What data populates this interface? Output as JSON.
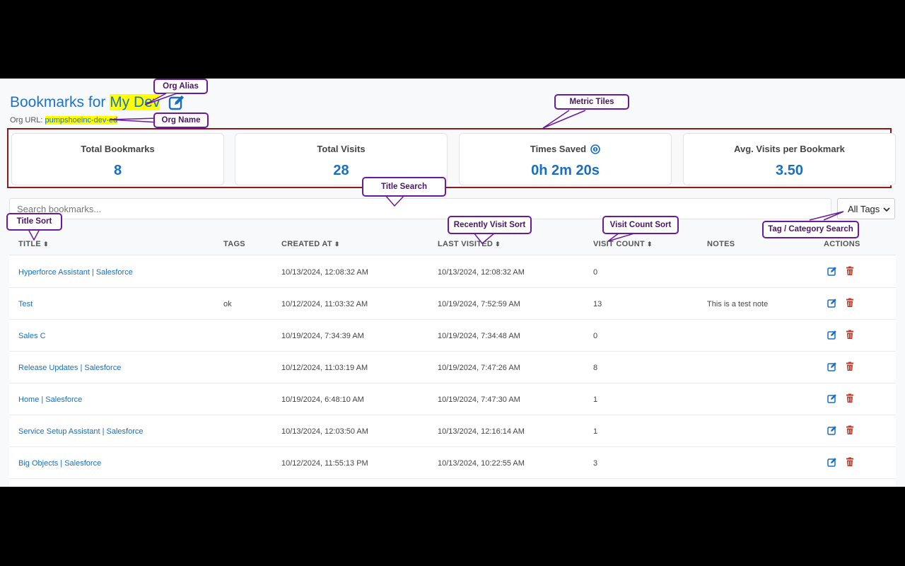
{
  "header": {
    "title_prefix": "Bookmarks for ",
    "org_alias": "My Dev",
    "org_url_label": "Org URL: ",
    "org_url_value": "pumpshoeinc-dev-ed"
  },
  "metrics": [
    {
      "label": "Total Bookmarks",
      "value": "8"
    },
    {
      "label": "Total Visits",
      "value": "28"
    },
    {
      "label": "Times Saved",
      "value": "0h 2m 20s"
    },
    {
      "label": "Avg. Visits per Bookmark",
      "value": "3.50"
    }
  ],
  "search": {
    "placeholder": "Search bookmarks..."
  },
  "tag_filter": {
    "selected": "All Tags"
  },
  "table": {
    "headers": {
      "title": "TITLE",
      "tags": "TAGS",
      "created": "CREATED AT",
      "last_visited": "LAST VISITED",
      "visit_count": "VISIT COUNT",
      "notes": "NOTES",
      "actions": "ACTIONS"
    },
    "rows": [
      {
        "title": "Hyperforce Assistant | Salesforce",
        "tags": "",
        "created": "10/13/2024, 12:08:32 AM",
        "last_visited": "10/13/2024, 12:08:32 AM",
        "visit_count": "0",
        "notes": ""
      },
      {
        "title": "Test",
        "tags": "ok",
        "created": "10/12/2024, 11:03:32 AM",
        "last_visited": "10/19/2024, 7:52:59 AM",
        "visit_count": "13",
        "notes": "This is a test note"
      },
      {
        "title": "Sales C",
        "tags": "",
        "created": "10/19/2024, 7:34:39 AM",
        "last_visited": "10/19/2024, 7:34:48 AM",
        "visit_count": "0",
        "notes": ""
      },
      {
        "title": "Release Updates | Salesforce",
        "tags": "",
        "created": "10/12/2024, 11:03:19 AM",
        "last_visited": "10/19/2024, 7:47:26 AM",
        "visit_count": "8",
        "notes": ""
      },
      {
        "title": "Home | Salesforce",
        "tags": "",
        "created": "10/19/2024, 6:48:10 AM",
        "last_visited": "10/19/2024, 7:47:30 AM",
        "visit_count": "1",
        "notes": ""
      },
      {
        "title": "Service Setup Assistant | Salesforce",
        "tags": "",
        "created": "10/13/2024, 12:03:50 AM",
        "last_visited": "10/13/2024, 12:16:14 AM",
        "visit_count": "1",
        "notes": ""
      },
      {
        "title": "Big Objects | Salesforce",
        "tags": "",
        "created": "10/12/2024, 11:55:13 PM",
        "last_visited": "10/13/2024, 10:22:55 AM",
        "visit_count": "3",
        "notes": ""
      }
    ]
  },
  "callouts": {
    "org_alias": "Org Alias",
    "org_name": "Org Name",
    "metric_tiles": "Metric Tiles",
    "title_search": "Title Search",
    "title_sort": "Title Sort",
    "recently_visit_sort": "Recently Visit Sort",
    "visit_count_sort": "Visit Count Sort",
    "tag_category_search": "Tag / Category Search"
  },
  "colors": {
    "accent": "#1a6ec0",
    "highlight": "#ffff00",
    "delete": "#c0392b",
    "callout_border": "#6a1b9a",
    "tiles_border": "#8b1a1a"
  }
}
